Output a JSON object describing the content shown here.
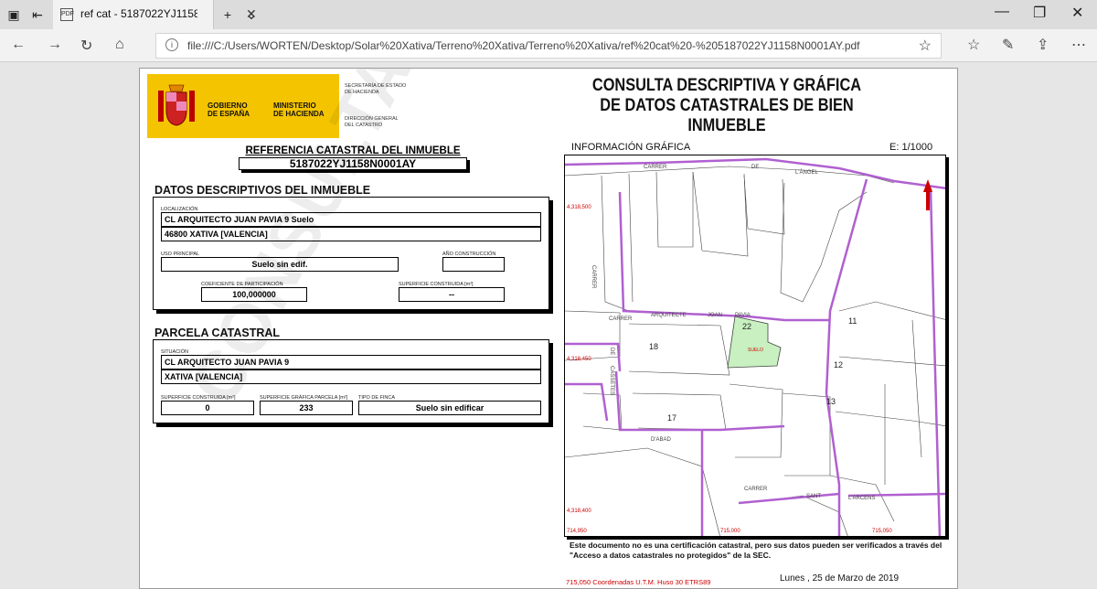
{
  "browser": {
    "tab_title": "ref cat - 5187022YJ1158",
    "tab_icon": "pdf-icon",
    "url": "file:///C:/Users/WORTEN/Desktop/Solar%20Xativa/Terreno%20Xativa/Terreno%20Xativa/ref%20cat%20-%205187022YJ1158N0001AY.pdf"
  },
  "logo": {
    "line1": "GOBIERNO",
    "line2": "DE ESPAÑA",
    "ministry1": "MINISTERIO",
    "ministry2": "DE HACIENDA",
    "sec1": "SECRETARÍA DE ESTADO",
    "sec2": "DE HACIENDA",
    "dir1": "DIRECCIÓN GENERAL",
    "dir2": "DEL CATASTRO"
  },
  "doc": {
    "title1": "CONSULTA DESCRIPTIVA Y GRÁFICA",
    "title2": "DE DATOS CATASTRALES DE BIEN INMUEBLE",
    "ref_label": "REFERENCIA CATASTRAL DEL INMUEBLE",
    "ref_value": "5187022YJ1158N0001AY",
    "desc_title": "DATOS DESCRIPTIVOS DEL INMUEBLE",
    "loc_cap": "LOCALIZACIÓN",
    "loc1": "CL ARQUITECTO JUAN PAVIA 9 Suelo",
    "loc2": "46800 XATIVA [VALENCIA]",
    "uso_cap": "USO PRINCIPAL",
    "uso": "Suelo sin edif.",
    "anio_cap": "AÑO CONSTRUCCIÓN",
    "anio": "",
    "coef_cap": "COEFICIENTE DE PARTICIPACIÓN",
    "coef": "100,000000",
    "sup_cap": "SUPERFICIE CONSTRUIDA [m²]",
    "sup": "--",
    "parcela_title": "PARCELA CATASTRAL",
    "sit_cap": "SITUACIÓN",
    "sit1": "CL ARQUITECTO JUAN PAVIA 9",
    "sit2": "XATIVA [VALENCIA]",
    "supc_cap": "SUPERFICIE CONSTRUIDA [m²]",
    "supc": "0",
    "supg_cap": "SUPERFICIE GRÁFICA PARCELA [m²]",
    "supg": "233",
    "tipo_cap": "TIPO DE FINCA",
    "tipo": "Suelo sin edificar",
    "map_title": "INFORMACIÓN GRÁFICA",
    "scale": "E: 1/1000",
    "watermark": "CONSULTA",
    "note": "Este documento no es una certificación catastral, pero sus datos pueden ser verificados a través del \"Acceso a datos catastrales no protegidos\" de la SEC.",
    "coord_foot": "715,050   Coordenadas U.T.M. Huso 30 ETRS89",
    "date": "Lunes , 25 de Marzo de 2019"
  },
  "map": {
    "coords": [
      "4,318,500",
      "4,318,450",
      "4,318,400",
      "714,950",
      "715,000",
      "715,050"
    ],
    "streets": [
      "CARRER",
      "DE",
      "L'ÀNGEL",
      "CARRER",
      "ARQUITECTE",
      "JOAN",
      "PAVIA",
      "D'ABAD",
      "CARRER",
      "SANT",
      "L'ARCENS",
      "CARRER",
      "DE",
      "CASSETES"
    ],
    "parcels": [
      "18",
      "22",
      "11",
      "12",
      "13",
      "17",
      "SUELO"
    ],
    "highlight_color": "#c8f0c0",
    "boundary_color": "#b060d0"
  }
}
